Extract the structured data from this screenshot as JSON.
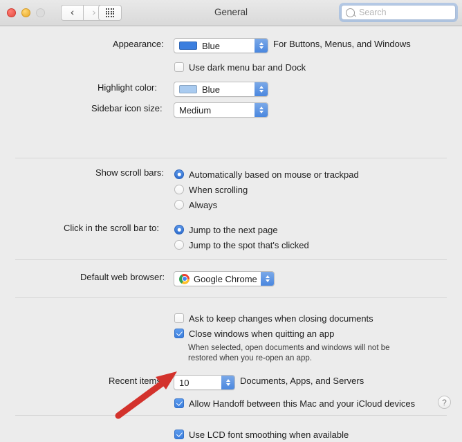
{
  "window": {
    "title": "General",
    "traffic_lights": [
      "close",
      "minimize",
      "zoom"
    ],
    "nav_back_glyph": "‹",
    "nav_forward_glyph": "›",
    "grid_button_name": "show-all-preferences"
  },
  "search": {
    "placeholder": "Search",
    "value": ""
  },
  "appearance": {
    "label": "Appearance:",
    "value": "Blue",
    "swatch_color": "#3b7ede",
    "trailing_text": "For Buttons, Menus, and Windows",
    "dark_menu_checkbox": {
      "label": "Use dark menu bar and Dock",
      "checked": false
    }
  },
  "highlight_color": {
    "label": "Highlight color:",
    "value": "Blue",
    "swatch_color": "#a9cbf0"
  },
  "sidebar_icon_size": {
    "label": "Sidebar icon size:",
    "value": "Medium"
  },
  "show_scroll_bars": {
    "label": "Show scroll bars:",
    "options": [
      {
        "label": "Automatically based on mouse or trackpad",
        "selected": true
      },
      {
        "label": "When scrolling",
        "selected": false
      },
      {
        "label": "Always",
        "selected": false
      }
    ]
  },
  "click_scroll_bar": {
    "label": "Click in the scroll bar to:",
    "options": [
      {
        "label": "Jump to the next page",
        "selected": true
      },
      {
        "label": "Jump to the spot that's clicked",
        "selected": false
      }
    ]
  },
  "default_web_browser": {
    "label": "Default web browser:",
    "value": "Google Chrome",
    "icon": "chrome-logo-icon"
  },
  "document_options": [
    {
      "label": "Ask to keep changes when closing documents",
      "checked": false
    },
    {
      "label": "Close windows when quitting an app",
      "checked": true
    }
  ],
  "close_windows_hint": {
    "line1": "When selected, open documents and windows will not be",
    "line2": "restored when you re-open an app."
  },
  "recent_items": {
    "label": "Recent items:",
    "value": "10",
    "trailing_text": "Documents, Apps, and Servers"
  },
  "handoff": {
    "label": "Allow Handoff between this Mac and your iCloud devices",
    "checked": true
  },
  "lcd_font_smoothing": {
    "label": "Use LCD font smoothing when available",
    "checked": true
  },
  "help_button": {
    "glyph": "?"
  },
  "annotation": {
    "arrow_color": "#d3322c",
    "points_at": "handoff-checkbox"
  }
}
